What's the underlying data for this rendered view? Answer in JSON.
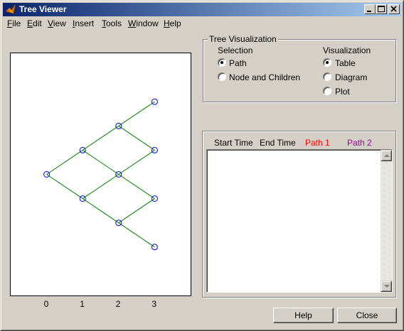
{
  "window": {
    "title": "Tree Viewer"
  },
  "menu": [
    {
      "label": "File",
      "mnemonic": "F",
      "rest": "ile"
    },
    {
      "label": "Edit",
      "mnemonic": "E",
      "rest": "dit"
    },
    {
      "label": "View",
      "mnemonic": "V",
      "rest": "iew"
    },
    {
      "label": "Insert",
      "mnemonic": "I",
      "rest": "nsert"
    },
    {
      "label": "Tools",
      "mnemonic": "T",
      "rest": "ools"
    },
    {
      "label": "Window",
      "mnemonic": "W",
      "rest": "indow"
    },
    {
      "label": "Help",
      "mnemonic": "H",
      "rest": "elp"
    }
  ],
  "chart_data": {
    "type": "scatter",
    "title": "",
    "xlabel": "",
    "ylabel": "",
    "x_ticks": [
      "0",
      "1",
      "2",
      "3"
    ],
    "xlim": [
      -1,
      4
    ],
    "ylim": [
      -5,
      5
    ],
    "nodes": [
      {
        "x": 0,
        "y": 0
      },
      {
        "x": 1,
        "y": 1
      },
      {
        "x": 1,
        "y": -1
      },
      {
        "x": 2,
        "y": 2
      },
      {
        "x": 2,
        "y": 0
      },
      {
        "x": 2,
        "y": -2
      },
      {
        "x": 3,
        "y": 3
      },
      {
        "x": 3,
        "y": 1
      },
      {
        "x": 3,
        "y": -1
      },
      {
        "x": 3,
        "y": -3
      }
    ],
    "edges": [
      [
        0,
        1
      ],
      [
        0,
        2
      ],
      [
        1,
        3
      ],
      [
        1,
        4
      ],
      [
        2,
        4
      ],
      [
        2,
        5
      ],
      [
        3,
        6
      ],
      [
        3,
        7
      ],
      [
        4,
        7
      ],
      [
        4,
        8
      ],
      [
        5,
        8
      ],
      [
        5,
        9
      ]
    ],
    "edge_color": "#008000",
    "node_color": "#0000ff"
  },
  "tree_visualization": {
    "title": "Tree Visualization",
    "selection": {
      "heading": "Selection",
      "options": [
        {
          "label": "Path",
          "checked": true
        },
        {
          "label": "Node and Children",
          "checked": false
        }
      ]
    },
    "visualization": {
      "heading": "Visualization",
      "options": [
        {
          "label": "Table",
          "checked": true
        },
        {
          "label": "Diagram",
          "checked": false
        },
        {
          "label": "Plot",
          "checked": false
        }
      ]
    }
  },
  "table": {
    "headers": [
      {
        "label": "Start Time",
        "color": "#000000"
      },
      {
        "label": "End Time",
        "color": "#000000"
      },
      {
        "label": "Path 1",
        "color": "#ff0000"
      },
      {
        "label": "Path 2",
        "color": "#a000a0"
      }
    ],
    "rows": []
  },
  "buttons": {
    "help": "Help",
    "close": "Close"
  }
}
